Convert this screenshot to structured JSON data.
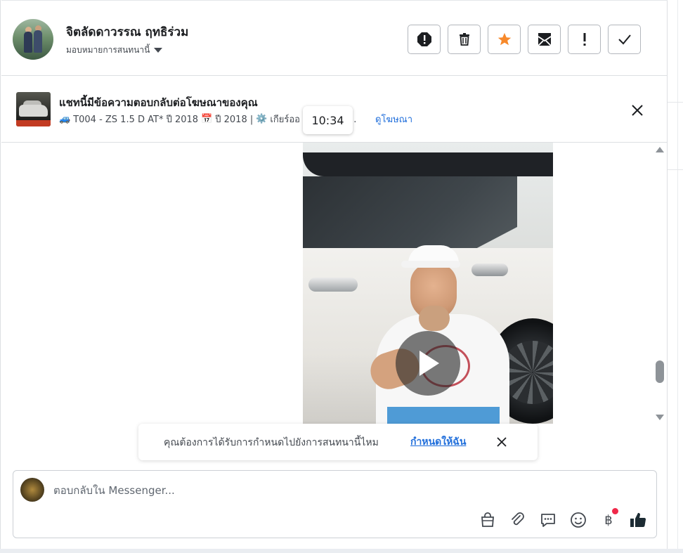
{
  "header": {
    "contact_name": "จิตลัดดาวรรณ ฤทธิร่วม",
    "assign_label": "มอบหมายการสนทนานี้",
    "actions": [
      {
        "name": "spam-icon",
        "label": "Spam"
      },
      {
        "name": "trash-icon",
        "label": "Delete"
      },
      {
        "name": "star-icon",
        "label": "Star"
      },
      {
        "name": "mark-unread-icon",
        "label": "Mark unread"
      },
      {
        "name": "exclamation-icon",
        "label": "Follow up"
      },
      {
        "name": "check-icon",
        "label": "Done"
      }
    ]
  },
  "ad_banner": {
    "title": "แชทนี้มีข้อความตอบกลับต่อโฆษณาของคุณ",
    "subtitle_parts": {
      "car_emoji": "🚙",
      "model": "T004 - ZS 1.5 D AT* ปี 2018",
      "calendar_emoji": "📅",
      "year": "ปี 2018 |",
      "gear_emoji": "⚙️",
      "gear": "เกียร์ออ",
      "ellipsis": "ี..."
    },
    "view_ad_link": "ดูโฆษณา"
  },
  "tooltip_time": "10:34",
  "assign_prompt": {
    "text": "คุณต้องการได้รับการกำหนดไปยังการสนทนานี้ไหม",
    "link": "กำหนดให้ฉัน"
  },
  "composer": {
    "placeholder": "ตอบกลับใน Messenger...",
    "baht_symbol": "฿"
  },
  "colors": {
    "star": "#f7892b",
    "link": "#216fdb",
    "like": "#1c2b33",
    "notify_dot": "#f02849"
  }
}
